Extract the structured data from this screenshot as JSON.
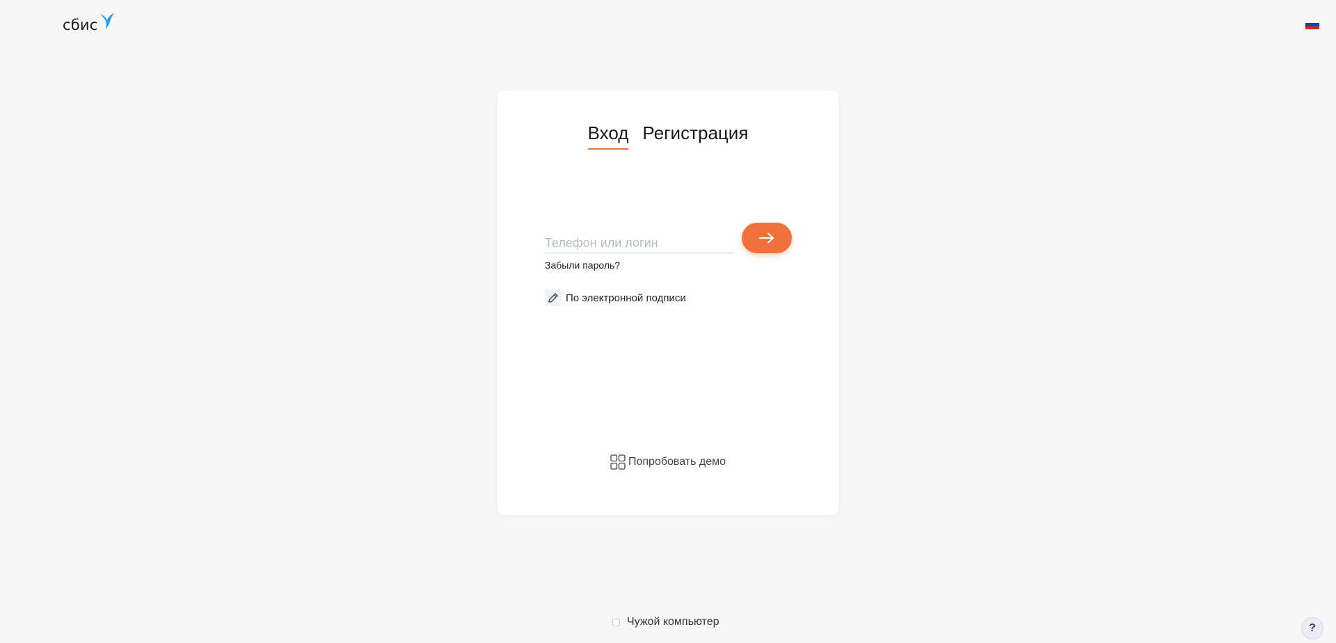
{
  "header": {
    "logo_text": "сбис",
    "logo_icon": "hummingbird-logo",
    "language_flag": "russian-flag-icon",
    "flag_colors": [
      "#ffffff",
      "#1c3fa8",
      "#d52b1e"
    ]
  },
  "login_card": {
    "tabs": [
      {
        "label": "Вход",
        "active": true
      },
      {
        "label": "Регистрация",
        "active": false
      }
    ],
    "login_input": {
      "value": "",
      "placeholder": "Телефон или логин"
    },
    "submit_icon": "arrow-right-icon",
    "forgot_password_label": "Забыли пароль?",
    "esign_label": "По электронной подписи",
    "esign_icon": "pencil-icon",
    "demo_label": "Попробовать демо",
    "demo_icon": "grid-icon"
  },
  "footer": {
    "foreign_computer_label": "Чужой компьютер",
    "foreign_computer_checked": false,
    "help_label": "?"
  },
  "colors": {
    "accent": "#f1713d",
    "background": "#f8f8f8",
    "card": "#ffffff",
    "logo_blue": "#1d9bf0"
  }
}
